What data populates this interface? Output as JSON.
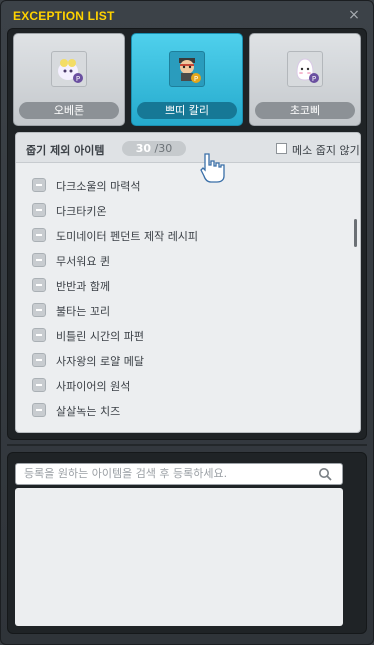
{
  "window": {
    "title": "EXCEPTION LIST",
    "close_icon": "×"
  },
  "pets": [
    {
      "name": "오베론",
      "icon": "oberon-pet-icon",
      "active": false
    },
    {
      "name": "쁘띠 칼리",
      "icon": "petit-kali-pet-icon",
      "active": true
    },
    {
      "name": "초코삐",
      "icon": "chocopi-pet-icon",
      "active": false
    }
  ],
  "list": {
    "title": "줍기 제외 아이템",
    "count_current": "30",
    "count_total": "/30",
    "meso_checkbox_label": "메소 줍지 않기",
    "meso_checkbox_checked": false,
    "items": [
      "다크소울의 마력석",
      "다크타키온",
      "도미네이터 펜던트 제작 레시피",
      "무서워요 퀸",
      "반반과 함께",
      "불타는 꼬리",
      "비틀린 시간의 파편",
      "사자왕의 로얄 메달",
      "사파이어의 원석",
      "살살녹는 치즈"
    ]
  },
  "search": {
    "placeholder": "등록을 원하는 아이템을 검색 후 등록하세요.",
    "icon": "search-icon"
  },
  "colors": {
    "title": "#ffd200",
    "active_tab": "#3cc3e3",
    "panel_bg": "#1f2326",
    "list_bg": "#eceef0"
  }
}
